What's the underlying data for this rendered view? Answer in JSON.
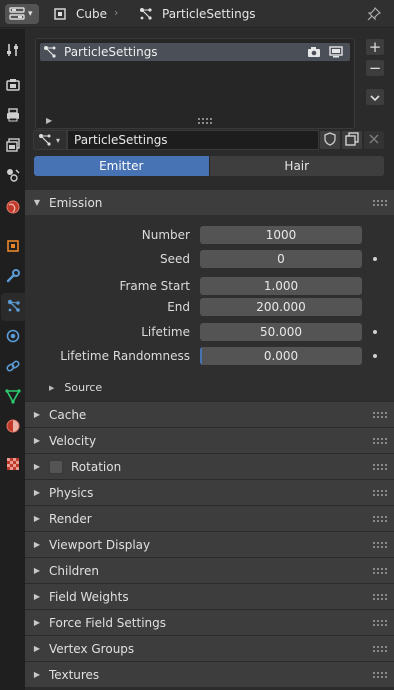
{
  "header": {
    "object_name": "Cube",
    "settings_name": "ParticleSettings"
  },
  "tabs": [
    {
      "name": "tool-tab",
      "icon": "tool-icon"
    },
    {
      "name": "render-tab",
      "icon": "render-icon"
    },
    {
      "name": "output-tab",
      "icon": "output-icon"
    },
    {
      "name": "view-layer-tab",
      "icon": "view-layer-icon"
    },
    {
      "name": "scene-tab",
      "icon": "scene-icon"
    },
    {
      "name": "world-tab",
      "icon": "world-icon"
    },
    {
      "name": "object-tab",
      "icon": "object-icon"
    },
    {
      "name": "modifiers-tab",
      "icon": "wrench-icon"
    },
    {
      "name": "particles-tab",
      "icon": "particles-icon",
      "active": true
    },
    {
      "name": "physics-tab",
      "icon": "physics-icon"
    },
    {
      "name": "constraints-tab",
      "icon": "constraints-icon"
    },
    {
      "name": "data-tab",
      "icon": "mesh-data-icon"
    },
    {
      "name": "material-tab",
      "icon": "material-icon"
    },
    {
      "name": "texture-tab",
      "icon": "texture-icon"
    }
  ],
  "particle_list": {
    "items": [
      {
        "name": "ParticleSettings"
      }
    ]
  },
  "settings_selector": {
    "name": "ParticleSettings"
  },
  "emitter_type": {
    "options": [
      "Emitter",
      "Hair"
    ],
    "selected": "Emitter"
  },
  "emission": {
    "title": "Emission",
    "number_label": "Number",
    "number_value": "1000",
    "seed_label": "Seed",
    "seed_value": "0",
    "frame_start_label": "Frame Start",
    "frame_start_value": "1.000",
    "end_label": "End",
    "end_value": "200.000",
    "lifetime_label": "Lifetime",
    "lifetime_value": "50.000",
    "lifetime_randomness_label": "Lifetime Randomness",
    "lifetime_randomness_value": "0.000",
    "lifetime_randomness_fraction": 0.0,
    "source_label": "Source"
  },
  "panels": [
    {
      "title": "Cache"
    },
    {
      "title": "Velocity"
    },
    {
      "title": "Rotation",
      "checkbox": true,
      "checked": false
    },
    {
      "title": "Physics"
    },
    {
      "title": "Render"
    },
    {
      "title": "Viewport Display"
    },
    {
      "title": "Children"
    },
    {
      "title": "Field Weights"
    },
    {
      "title": "Force Field Settings"
    },
    {
      "title": "Vertex Groups"
    },
    {
      "title": "Textures"
    }
  ],
  "colors": {
    "accent": "#4772b3",
    "panel_header": "#3d3d3d",
    "background": "#2b2b2b"
  }
}
